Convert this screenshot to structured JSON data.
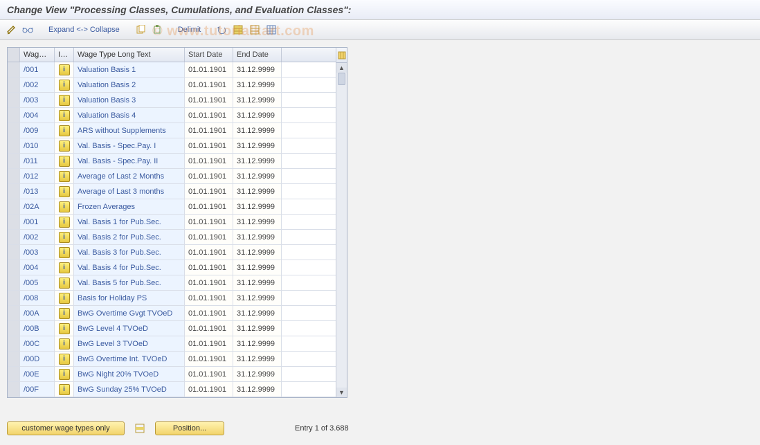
{
  "title": "Change View \"Processing Classes, Cumulations, and Evaluation Classes\":",
  "toolbar": {
    "expand_collapse": "Expand <-> Collapse",
    "delimit": "Delimit"
  },
  "columns": {
    "wage_type": "Wage Ty...",
    "info": "Inf...",
    "long_text": "Wage Type Long Text",
    "start_date": "Start Date",
    "end_date": "End Date"
  },
  "rows": [
    {
      "wt": "/001",
      "txt": "Valuation Basis 1",
      "sd": "01.01.1901",
      "ed": "31.12.9999"
    },
    {
      "wt": "/002",
      "txt": "Valuation Basis 2",
      "sd": "01.01.1901",
      "ed": "31.12.9999"
    },
    {
      "wt": "/003",
      "txt": "Valuation Basis 3",
      "sd": "01.01.1901",
      "ed": "31.12.9999"
    },
    {
      "wt": "/004",
      "txt": "Valuation Basis 4",
      "sd": "01.01.1901",
      "ed": "31.12.9999"
    },
    {
      "wt": "/009",
      "txt": "ARS without Supplements",
      "sd": "01.01.1901",
      "ed": "31.12.9999"
    },
    {
      "wt": "/010",
      "txt": "Val. Basis - Spec.Pay. I",
      "sd": "01.01.1901",
      "ed": "31.12.9999"
    },
    {
      "wt": "/011",
      "txt": "Val. Basis - Spec.Pay. II",
      "sd": "01.01.1901",
      "ed": "31.12.9999"
    },
    {
      "wt": "/012",
      "txt": "Average of Last 2 Months",
      "sd": "01.01.1901",
      "ed": "31.12.9999"
    },
    {
      "wt": "/013",
      "txt": "Average of Last 3 months",
      "sd": "01.01.1901",
      "ed": "31.12.9999"
    },
    {
      "wt": "/02A",
      "txt": "Frozen Averages",
      "sd": "01.01.1901",
      "ed": "31.12.9999"
    },
    {
      "wt": "/001",
      "txt": "Val. Basis 1 for Pub.Sec.",
      "sd": "01.01.1901",
      "ed": "31.12.9999"
    },
    {
      "wt": "/002",
      "txt": "Val. Basis 2 for Pub.Sec.",
      "sd": "01.01.1901",
      "ed": "31.12.9999"
    },
    {
      "wt": "/003",
      "txt": "Val. Basis 3 for Pub.Sec.",
      "sd": "01.01.1901",
      "ed": "31.12.9999"
    },
    {
      "wt": "/004",
      "txt": "Val. Basis 4 for Pub.Sec.",
      "sd": "01.01.1901",
      "ed": "31.12.9999"
    },
    {
      "wt": "/005",
      "txt": "Val. Basis 5 for Pub.Sec.",
      "sd": "01.01.1901",
      "ed": "31.12.9999"
    },
    {
      "wt": "/008",
      "txt": "Basis for Holiday PS",
      "sd": "01.01.1901",
      "ed": "31.12.9999"
    },
    {
      "wt": "/00A",
      "txt": "BwG Overtime Gvgt TVOeD",
      "sd": "01.01.1901",
      "ed": "31.12.9999"
    },
    {
      "wt": "/00B",
      "txt": "BwG Level 4 TVOeD",
      "sd": "01.01.1901",
      "ed": "31.12.9999"
    },
    {
      "wt": "/00C",
      "txt": "BwG Level 3 TVOeD",
      "sd": "01.01.1901",
      "ed": "31.12.9999"
    },
    {
      "wt": "/00D",
      "txt": "BwG Overtime Int. TVOeD",
      "sd": "01.01.1901",
      "ed": "31.12.9999"
    },
    {
      "wt": "/00E",
      "txt": "BwG Night 20% TVOeD",
      "sd": "01.01.1901",
      "ed": "31.12.9999"
    },
    {
      "wt": "/00F",
      "txt": "BwG Sunday 25% TVOeD",
      "sd": "01.01.1901",
      "ed": "31.12.9999"
    }
  ],
  "footer": {
    "customer_btn": "customer wage types only",
    "position_btn": "Position...",
    "entry": "Entry 1 of 3.688"
  },
  "watermark": "© www.tutorialkart.com"
}
